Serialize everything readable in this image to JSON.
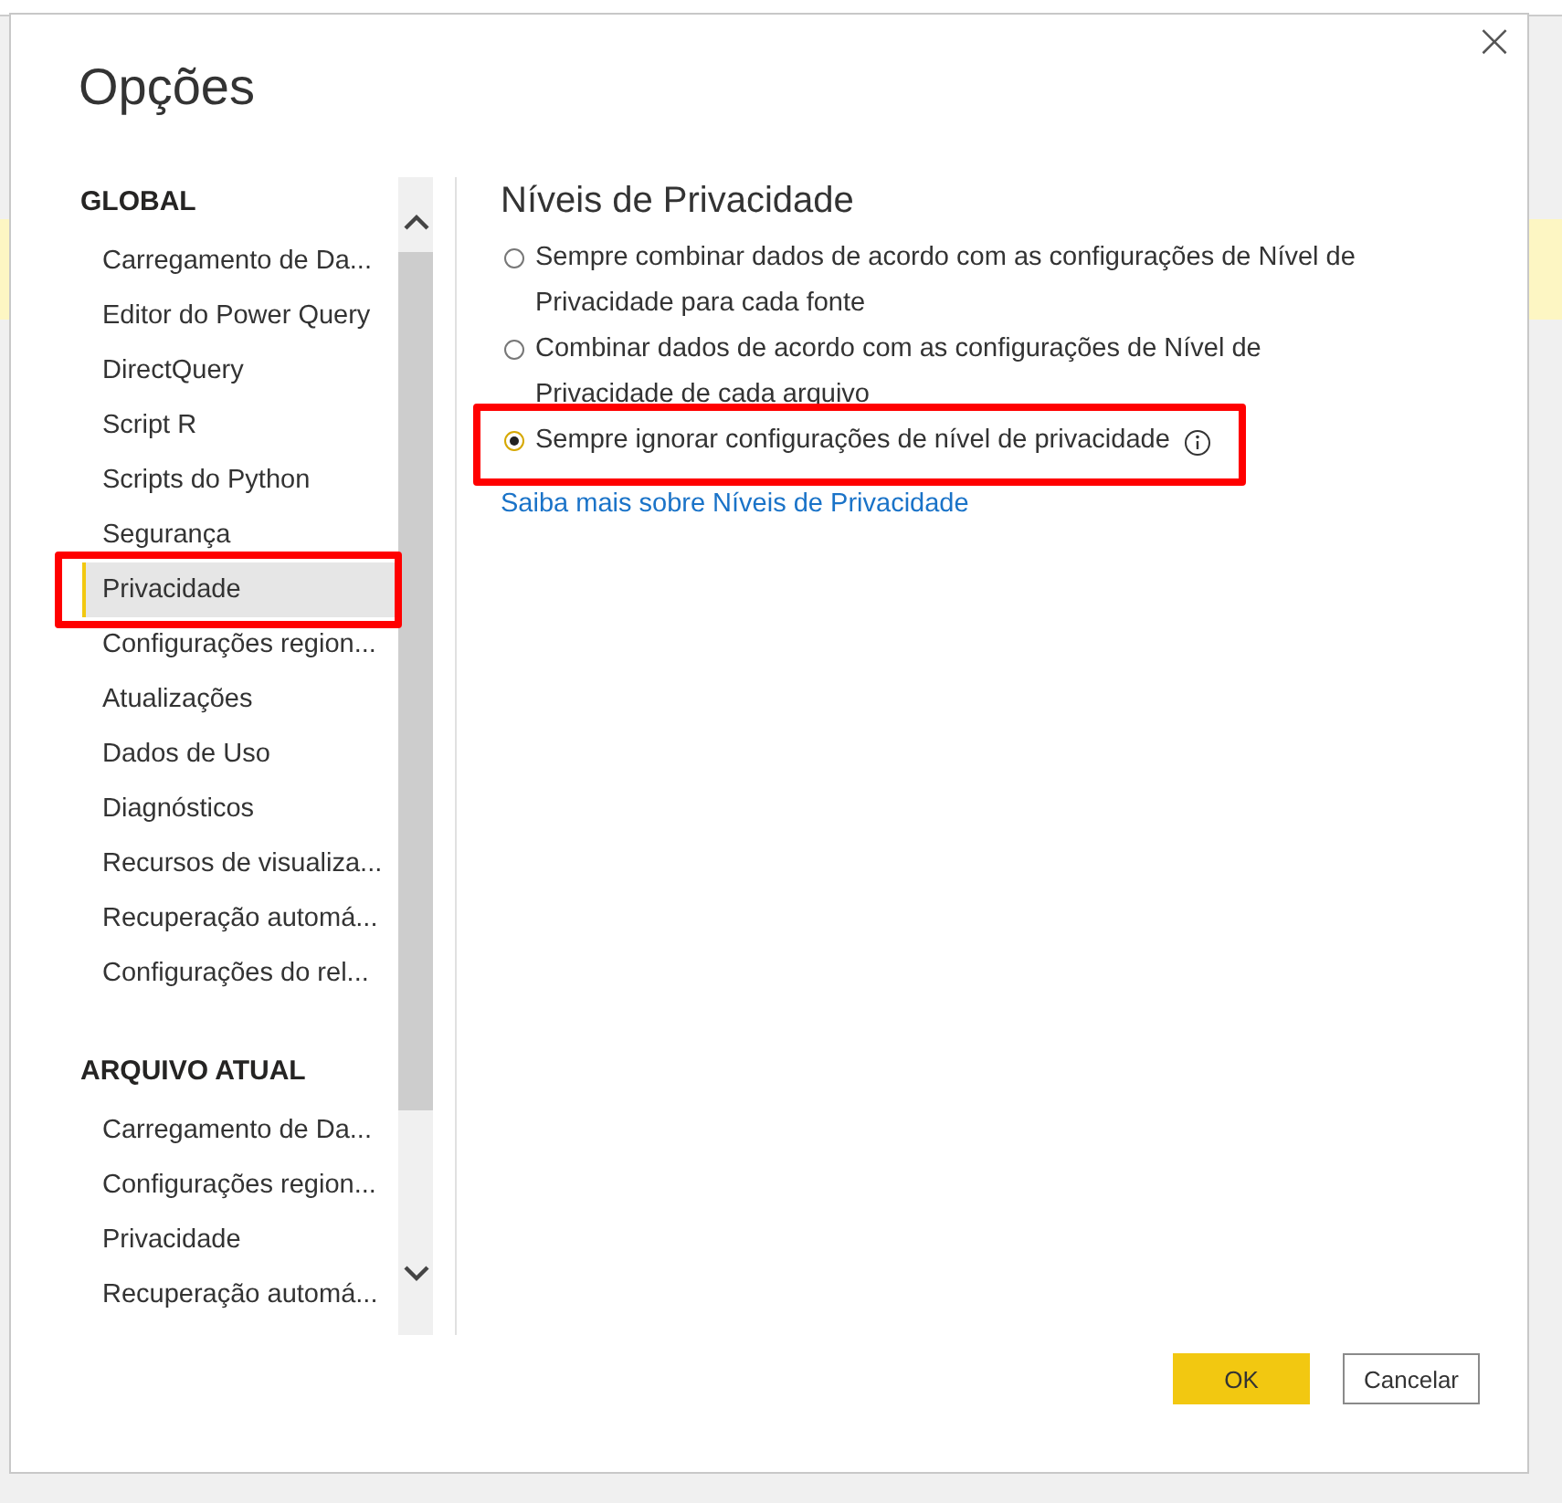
{
  "dialog": {
    "title": "Opções",
    "close_icon": "×"
  },
  "sidebar": {
    "sections": [
      {
        "heading": "GLOBAL",
        "items": [
          {
            "label": "Carregamento de Da...",
            "selected": false,
            "highlighted": false
          },
          {
            "label": "Editor do Power Query",
            "selected": false,
            "highlighted": false
          },
          {
            "label": "DirectQuery",
            "selected": false,
            "highlighted": false
          },
          {
            "label": "Script R",
            "selected": false,
            "highlighted": false
          },
          {
            "label": "Scripts do Python",
            "selected": false,
            "highlighted": false
          },
          {
            "label": "Segurança",
            "selected": false,
            "highlighted": false
          },
          {
            "label": "Privacidade",
            "selected": true,
            "highlighted": true
          },
          {
            "label": "Configurações region...",
            "selected": false,
            "highlighted": false
          },
          {
            "label": "Atualizações",
            "selected": false,
            "highlighted": false
          },
          {
            "label": "Dados de Uso",
            "selected": false,
            "highlighted": false
          },
          {
            "label": "Diagnósticos",
            "selected": false,
            "highlighted": false
          },
          {
            "label": "Recursos de visualiza...",
            "selected": false,
            "highlighted": false
          },
          {
            "label": "Recuperação automá...",
            "selected": false,
            "highlighted": false
          },
          {
            "label": "Configurações do rel...",
            "selected": false,
            "highlighted": false
          }
        ]
      },
      {
        "heading": "ARQUIVO ATUAL",
        "items": [
          {
            "label": "Carregamento de Da...",
            "selected": false,
            "highlighted": false
          },
          {
            "label": "Configurações region...",
            "selected": false,
            "highlighted": false
          },
          {
            "label": "Privacidade",
            "selected": false,
            "highlighted": false
          },
          {
            "label": "Recuperação automá...",
            "selected": false,
            "highlighted": false
          }
        ]
      }
    ]
  },
  "content": {
    "heading": "Níveis de Privacidade",
    "options": [
      {
        "label": "Sempre combinar dados de acordo com as configurações de Nível de Privacidade para cada fonte",
        "selected": false,
        "highlighted": false,
        "info": false
      },
      {
        "label": "Combinar dados de acordo com as configurações de Nível de Privacidade de cada arquivo",
        "selected": false,
        "highlighted": false,
        "info": false
      },
      {
        "label": "Sempre ignorar configurações de nível de privacidade",
        "selected": true,
        "highlighted": true,
        "info": true
      }
    ],
    "link": "Saiba mais sobre Níveis de Privacidade"
  },
  "buttons": [
    {
      "label": "OK",
      "kind": "primary"
    },
    {
      "label": "Cancelar",
      "kind": "secondary"
    }
  ]
}
